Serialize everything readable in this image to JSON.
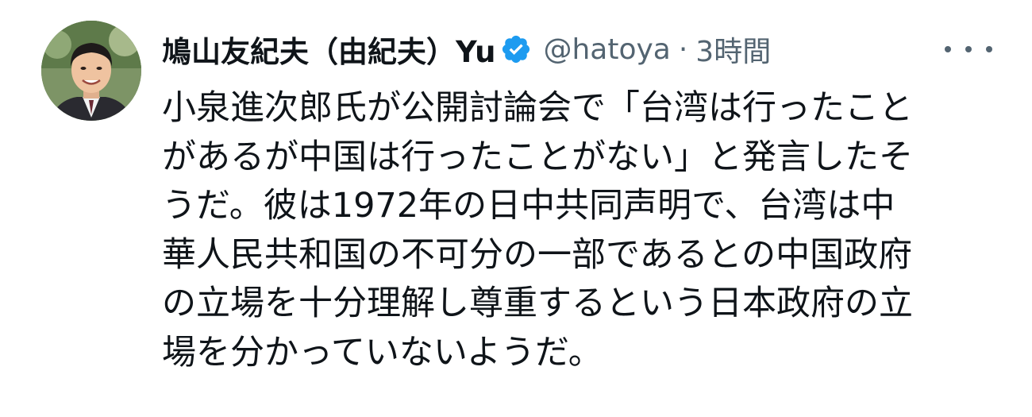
{
  "tweet": {
    "author": {
      "display_name": "鳩山友紀夫（由紀夫）Yu",
      "handle": "@hatoya",
      "verified_icon": "verified-badge-icon",
      "avatar": "profile-photo"
    },
    "separator": "·",
    "timestamp": "3時間",
    "more_icon": "more-options-icon",
    "body_lines": [
      "小泉進次郎氏が公開討論会で「台湾は行ったこと",
      "があるが中国は行ったことがない」と発言したそ",
      "うだ。彼は1972年の日中共同声明で、台湾は中",
      "華人民共和国の不可分の一部であるとの中国政府",
      "の立場を十分理解し尊重するという日本政府の立",
      "場を分かっていないようだ。"
    ]
  },
  "colors": {
    "text_primary": "#0f1419",
    "text_secondary": "#536471",
    "verified_blue": "#1d9bf0",
    "background": "#ffffff"
  }
}
